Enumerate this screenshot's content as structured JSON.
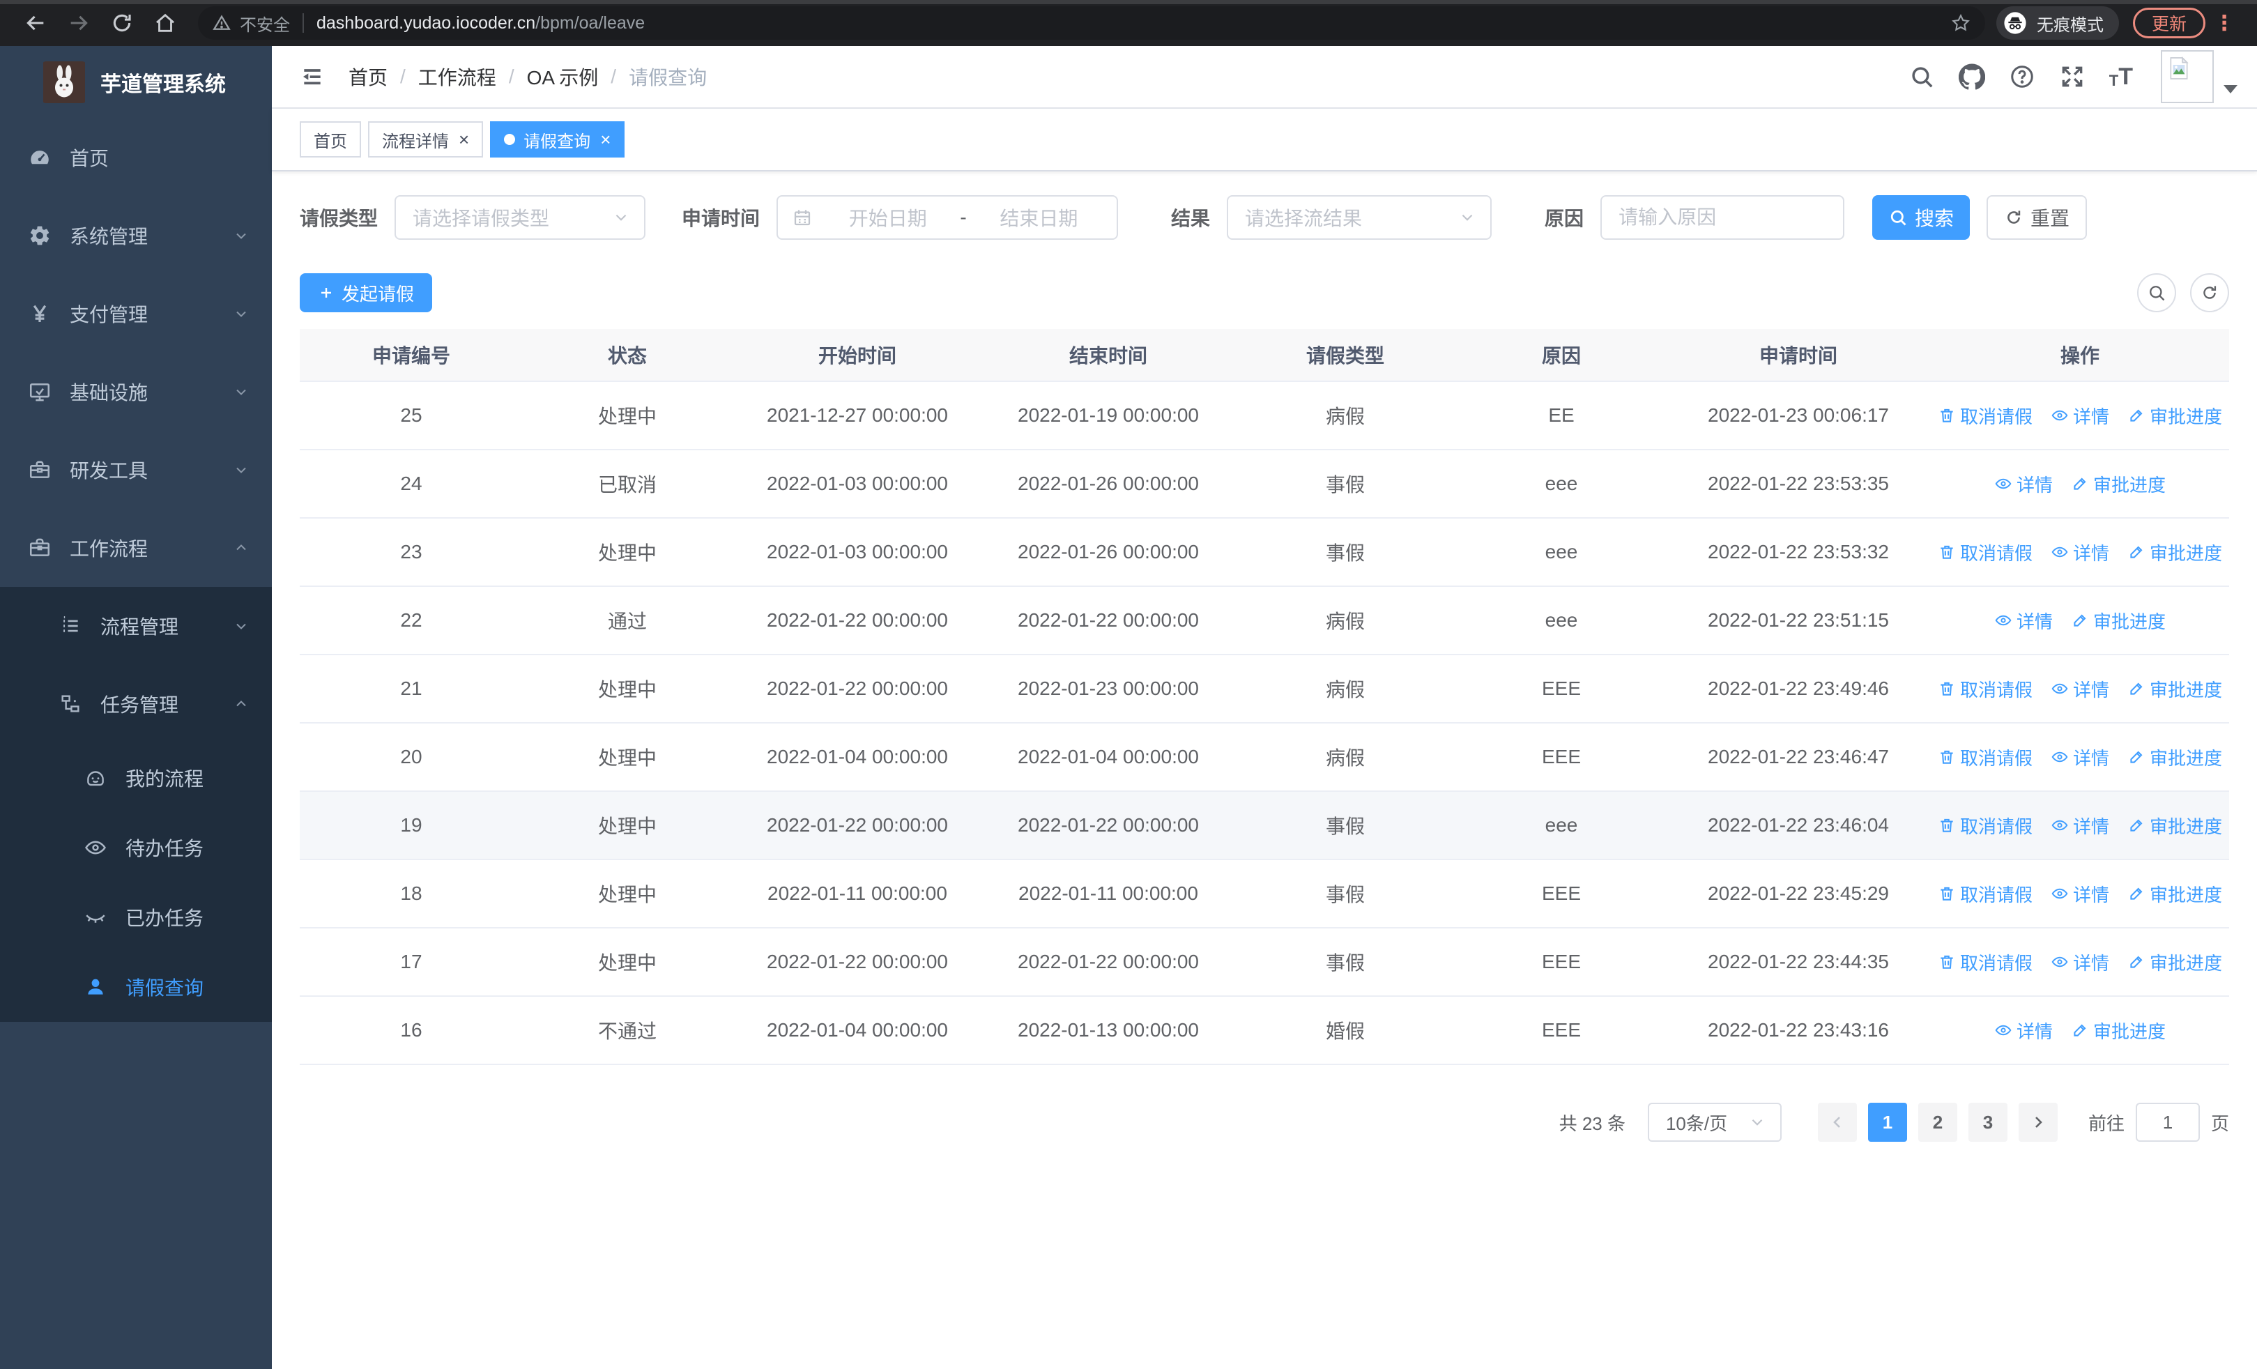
{
  "browser": {
    "security_label": "不安全",
    "url_host": "dashboard.yudao.iocoder.cn",
    "url_path": "/bpm/oa/leave",
    "incognito_label": "无痕模式",
    "update_label": "更新"
  },
  "colors": {
    "accent": "#409eff",
    "sidebar_bg": "#304156",
    "submenu_bg": "#1f2d3d",
    "chrome_update": "#f08779"
  },
  "sidebar": {
    "logo_title": "芋道管理系统",
    "menu": [
      {
        "label": "首页",
        "icon": "gauge-icon",
        "level": 1
      },
      {
        "label": "系统管理",
        "icon": "gear-icon",
        "level": 1,
        "arrow": "down"
      },
      {
        "label": "支付管理",
        "icon": "yen-icon",
        "level": 1,
        "arrow": "down"
      },
      {
        "label": "基础设施",
        "icon": "monitor-icon",
        "level": 1,
        "arrow": "down"
      },
      {
        "label": "研发工具",
        "icon": "toolbox-icon",
        "level": 1,
        "arrow": "down"
      },
      {
        "label": "工作流程",
        "icon": "briefcase-icon",
        "level": 1,
        "arrow": "up"
      }
    ],
    "submenu": [
      {
        "label": "流程管理",
        "icon": "list-icon",
        "level": 2,
        "arrow": "down"
      },
      {
        "label": "任务管理",
        "icon": "tree-icon",
        "level": 2,
        "arrow": "up"
      },
      {
        "label": "我的流程",
        "icon": "robot-icon",
        "level": 3
      },
      {
        "label": "待办任务",
        "icon": "eye-icon",
        "level": 3
      },
      {
        "label": "已办任务",
        "icon": "eye-closed-icon",
        "level": 3
      },
      {
        "label": "请假查询",
        "icon": "user-icon",
        "level": 3,
        "active": true
      }
    ]
  },
  "breadcrumb": [
    "首页",
    "工作流程",
    "OA 示例",
    "请假查询"
  ],
  "tabs": [
    {
      "label": "首页",
      "closable": false,
      "active": false
    },
    {
      "label": "流程详情",
      "closable": true,
      "active": false
    },
    {
      "label": "请假查询",
      "closable": true,
      "active": true
    }
  ],
  "filters": {
    "type_label": "请假类型",
    "type_placeholder": "请选择请假类型",
    "time_label": "申请时间",
    "start_placeholder": "开始日期",
    "range_separator": "-",
    "end_placeholder": "结束日期",
    "result_label": "结果",
    "result_placeholder": "请选择流结果",
    "reason_label": "原因",
    "reason_placeholder": "请输入原因",
    "search_label": "搜索",
    "reset_label": "重置"
  },
  "toolbar": {
    "create_label": "发起请假"
  },
  "table": {
    "columns": [
      "申请编号",
      "状态",
      "开始时间",
      "结束时间",
      "请假类型",
      "原因",
      "申请时间",
      "操作"
    ],
    "rows": [
      {
        "id": "25",
        "status": "处理中",
        "start": "2021-12-27 00:00:00",
        "end": "2022-01-19 00:00:00",
        "type": "病假",
        "reason": "EE",
        "applied": "2022-01-23 00:06:17",
        "actions": [
          "cancel",
          "detail",
          "progress"
        ]
      },
      {
        "id": "24",
        "status": "已取消",
        "start": "2022-01-03 00:00:00",
        "end": "2022-01-26 00:00:00",
        "type": "事假",
        "reason": "eee",
        "applied": "2022-01-22 23:53:35",
        "actions": [
          "detail",
          "progress"
        ]
      },
      {
        "id": "23",
        "status": "处理中",
        "start": "2022-01-03 00:00:00",
        "end": "2022-01-26 00:00:00",
        "type": "事假",
        "reason": "eee",
        "applied": "2022-01-22 23:53:32",
        "actions": [
          "cancel",
          "detail",
          "progress"
        ]
      },
      {
        "id": "22",
        "status": "通过",
        "start": "2022-01-22 00:00:00",
        "end": "2022-01-22 00:00:00",
        "type": "病假",
        "reason": "eee",
        "applied": "2022-01-22 23:51:15",
        "actions": [
          "detail",
          "progress"
        ]
      },
      {
        "id": "21",
        "status": "处理中",
        "start": "2022-01-22 00:00:00",
        "end": "2022-01-23 00:00:00",
        "type": "病假",
        "reason": "EEE",
        "applied": "2022-01-22 23:49:46",
        "actions": [
          "cancel",
          "detail",
          "progress"
        ]
      },
      {
        "id": "20",
        "status": "处理中",
        "start": "2022-01-04 00:00:00",
        "end": "2022-01-04 00:00:00",
        "type": "病假",
        "reason": "EEE",
        "applied": "2022-01-22 23:46:47",
        "actions": [
          "cancel",
          "detail",
          "progress"
        ]
      },
      {
        "id": "19",
        "status": "处理中",
        "start": "2022-01-22 00:00:00",
        "end": "2022-01-22 00:00:00",
        "type": "事假",
        "reason": "eee",
        "applied": "2022-01-22 23:46:04",
        "actions": [
          "cancel",
          "detail",
          "progress"
        ],
        "hovered": true
      },
      {
        "id": "18",
        "status": "处理中",
        "start": "2022-01-11 00:00:00",
        "end": "2022-01-11 00:00:00",
        "type": "事假",
        "reason": "EEE",
        "applied": "2022-01-22 23:45:29",
        "actions": [
          "cancel",
          "detail",
          "progress"
        ]
      },
      {
        "id": "17",
        "status": "处理中",
        "start": "2022-01-22 00:00:00",
        "end": "2022-01-22 00:00:00",
        "type": "事假",
        "reason": "EEE",
        "applied": "2022-01-22 23:44:35",
        "actions": [
          "cancel",
          "detail",
          "progress"
        ]
      },
      {
        "id": "16",
        "status": "不通过",
        "start": "2022-01-04 00:00:00",
        "end": "2022-01-13 00:00:00",
        "type": "婚假",
        "reason": "EEE",
        "applied": "2022-01-22 23:43:16",
        "actions": [
          "detail",
          "progress"
        ]
      }
    ]
  },
  "actions_labels": {
    "cancel": "取消请假",
    "detail": "详情",
    "progress": "审批进度"
  },
  "pagination": {
    "total_label": "共 23 条",
    "page_size": "10条/页",
    "pages": [
      "1",
      "2",
      "3"
    ],
    "active_page": "1",
    "goto_prefix": "前往",
    "goto_value": "1",
    "goto_suffix": "页"
  }
}
